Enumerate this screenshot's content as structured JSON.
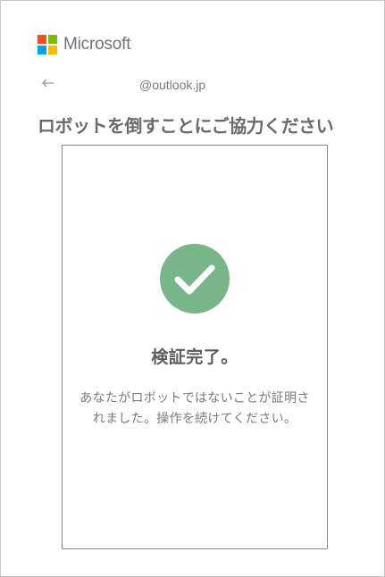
{
  "brand": {
    "name": "Microsoft",
    "logo_colors": [
      "#f25022",
      "#7fba00",
      "#00a4ef",
      "#ffb900"
    ]
  },
  "header": {
    "back_icon": "arrow-left-icon",
    "identity": "@outlook.jp"
  },
  "page": {
    "title": "ロボットを倒すことにご協力ください"
  },
  "verification": {
    "status_icon": "checkmark-icon",
    "status_color": "#78b589",
    "title": "検証完了。",
    "message": "あなたがロボットではないことが証明されました。操作を続けてください。"
  }
}
